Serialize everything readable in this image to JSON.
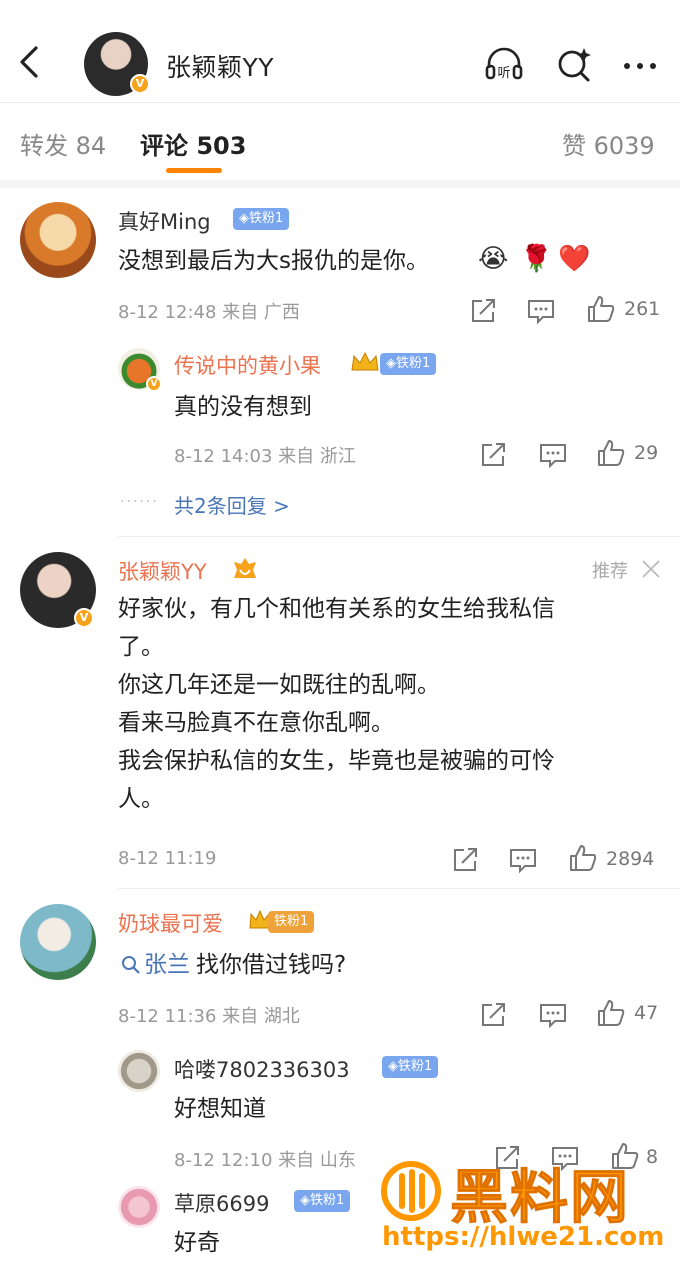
{
  "header": {
    "title": "张颖颖YY",
    "listen_label": "听"
  },
  "tabs": {
    "repost": "转发 84",
    "comment": "评论 503",
    "like": "赞 6039"
  },
  "comments": [
    {
      "user": "真好Ming",
      "badge": "◈铁粉1",
      "text": "没想到最后为大s报仇的是你。",
      "emojis": [
        "😭",
        "🌹",
        "❤️"
      ],
      "meta": "8-12 12:48  来自 广西",
      "likes": "261",
      "replies": [
        {
          "user": "传说中的黄小果",
          "badge": "◈铁粉1",
          "text": "真的没有想到",
          "meta": "8-12 14:03  来自 浙江",
          "likes": "29"
        }
      ],
      "more": "共2条回复 >"
    },
    {
      "user": "张颖颖YY",
      "recommend": "推荐",
      "lines": [
        "好家伙，有几个和他有关系的女生给我私信",
        "了。",
        "你这几年还是一如既往的乱啊。",
        "看来马脸真不在意你乱啊。",
        "我会保护私信的女生，毕竟也是被骗的可怜",
        "人。"
      ],
      "meta": "8-12 11:19",
      "likes": "2894"
    },
    {
      "user": "奶球最可爱",
      "badge": "铁粉1",
      "mention": "张兰",
      "text": "找你借过钱吗?",
      "meta": "8-12 11:36  来自 湖北",
      "likes": "47",
      "replies": [
        {
          "user": "哈喽7802336303",
          "badge": "◈铁粉1",
          "text": "好想知道",
          "meta": "8-12 12:10  来自 山东",
          "likes": "8"
        },
        {
          "user": "草原6699",
          "badge": "◈铁粉1",
          "text": "好奇"
        }
      ]
    }
  ],
  "watermark": {
    "title": "黑料网",
    "url": "https://hlwe21.com"
  },
  "colors": {
    "accent": "#ff8200",
    "username_orange": "#eb7350",
    "badge_blue": "#7aa6f0",
    "link_blue": "#4a76b8"
  }
}
